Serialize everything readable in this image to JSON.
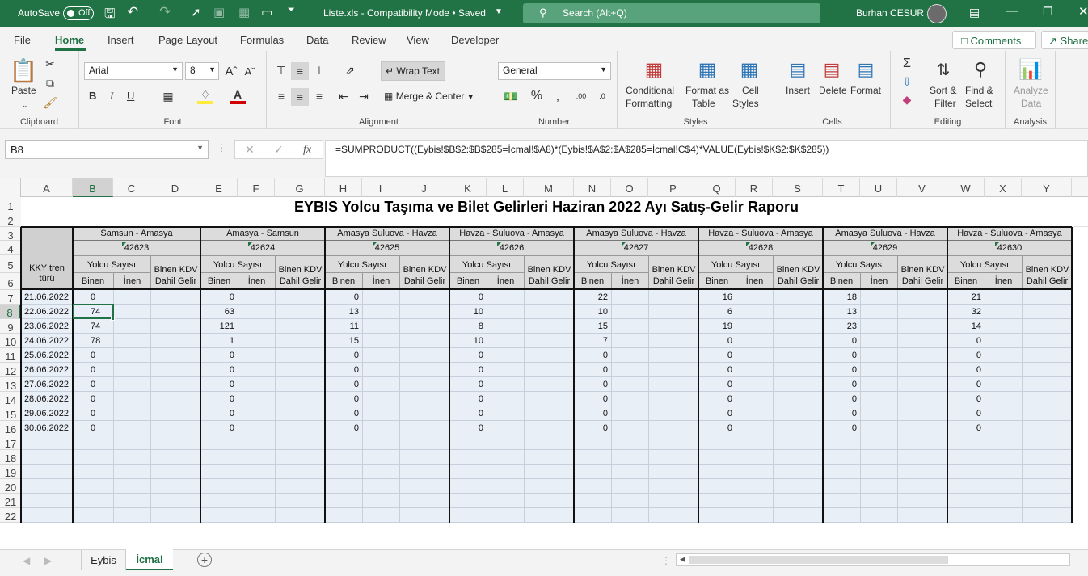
{
  "titlebar": {
    "autosave_label": "AutoSave",
    "autosave_state": "Off",
    "doc_title": "Liste.xls  -  Compatibility Mode • Saved",
    "search_placeholder": "Search (Alt+Q)",
    "user": "Burhan CESUR"
  },
  "tabs": [
    "File",
    "Home",
    "Insert",
    "Page Layout",
    "Formulas",
    "Data",
    "Review",
    "View",
    "Developer"
  ],
  "share": {
    "comments": "Comments",
    "share": "Share"
  },
  "ribbon": {
    "clipboard": {
      "paste": "Paste",
      "label": "Clipboard"
    },
    "font": {
      "name": "Arial",
      "size": "8",
      "bold": "B",
      "italic": "I",
      "underline": "U",
      "label": "Font"
    },
    "alignment": {
      "wrap": "Wrap Text",
      "merge": "Merge & Center",
      "label": "Alignment"
    },
    "number": {
      "format": "General",
      "label": "Number"
    },
    "styles": {
      "cond1": "Conditional",
      "cond2": "Formatting",
      "fmt1": "Format as",
      "fmt2": "Table",
      "cell1": "Cell",
      "cell2": "Styles",
      "label": "Styles"
    },
    "cells": {
      "insert": "Insert",
      "delete": "Delete",
      "format": "Format",
      "label": "Cells"
    },
    "editing": {
      "sort1": "Sort &",
      "sort2": "Filter",
      "find1": "Find &",
      "find2": "Select",
      "label": "Editing"
    },
    "analysis": {
      "a1": "Analyze",
      "a2": "Data",
      "label": "Analysis"
    }
  },
  "formula_bar": {
    "name_box": "B8",
    "fx": "fx",
    "formula": "=SUMPRODUCT((Eybis!$B$2:$B$285=İcmal!$A8)*(Eybis!$A$2:$A$285=İcmal!C$4)*VALUE(Eybis!$K$2:$K$285))"
  },
  "columns": [
    "A",
    "B",
    "C",
    "D",
    "E",
    "F",
    "G",
    "H",
    "I",
    "J",
    "K",
    "L",
    "M",
    "N",
    "O",
    "P",
    "Q",
    "R",
    "S",
    "T",
    "U",
    "V",
    "W",
    "X",
    "Y"
  ],
  "rows": [
    "1",
    "2",
    "3",
    "4",
    "5",
    "6",
    "7",
    "8",
    "9",
    "10",
    "11",
    "12",
    "13",
    "14",
    "15",
    "16",
    "17",
    "18",
    "19",
    "20",
    "21",
    "22"
  ],
  "sheet": {
    "title": "EYBIS Yolcu Taşıma ve Bilet Gelirleri Haziran 2022 Ayı Satış-Gelir Raporu",
    "a_header": "KKY tren türü",
    "yolcu": "Yolcu Sayısı",
    "gelir": "Binen KDV Dahil Gelir",
    "binen": "Binen",
    "inen": "İnen",
    "groups": [
      {
        "route": "Samsun - Amasya",
        "code": "42623",
        "values": [
          "0",
          "74",
          "74",
          "78",
          "0",
          "0",
          "0",
          "0",
          "0",
          "0"
        ]
      },
      {
        "route": "Amasya - Samsun",
        "code": "42624",
        "values": [
          "0",
          "63",
          "121",
          "1",
          "0",
          "0",
          "0",
          "0",
          "0",
          "0"
        ]
      },
      {
        "route": "Amasya Suluova - Havza",
        "code": "42625",
        "values": [
          "0",
          "13",
          "11",
          "15",
          "0",
          "0",
          "0",
          "0",
          "0",
          "0"
        ]
      },
      {
        "route": "Havza - Suluova - Amasya",
        "code": "42626",
        "values": [
          "0",
          "10",
          "8",
          "10",
          "0",
          "0",
          "0",
          "0",
          "0",
          "0"
        ]
      },
      {
        "route": "Amasya Suluova - Havza",
        "code": "42627",
        "values": [
          "22",
          "10",
          "15",
          "7",
          "0",
          "0",
          "0",
          "0",
          "0",
          "0"
        ]
      },
      {
        "route": "Havza - Suluova - Amasya",
        "code": "42628",
        "values": [
          "16",
          "6",
          "19",
          "0",
          "0",
          "0",
          "0",
          "0",
          "0",
          "0"
        ]
      },
      {
        "route": "Amasya Suluova - Havza",
        "code": "42629",
        "values": [
          "18",
          "13",
          "23",
          "0",
          "0",
          "0",
          "0",
          "0",
          "0",
          "0"
        ]
      },
      {
        "route": "Havza - Suluova - Amasya",
        "code": "42630",
        "values": [
          "21",
          "32",
          "14",
          "0",
          "0",
          "0",
          "0",
          "0",
          "0",
          "0"
        ]
      }
    ],
    "dates": [
      "21.06.2022",
      "22.06.2022",
      "23.06.2022",
      "24.06.2022",
      "25.06.2022",
      "26.06.2022",
      "27.06.2022",
      "28.06.2022",
      "29.06.2022",
      "30.06.2022"
    ]
  },
  "sheet_tabs": [
    "Eybis",
    "İcmal"
  ]
}
